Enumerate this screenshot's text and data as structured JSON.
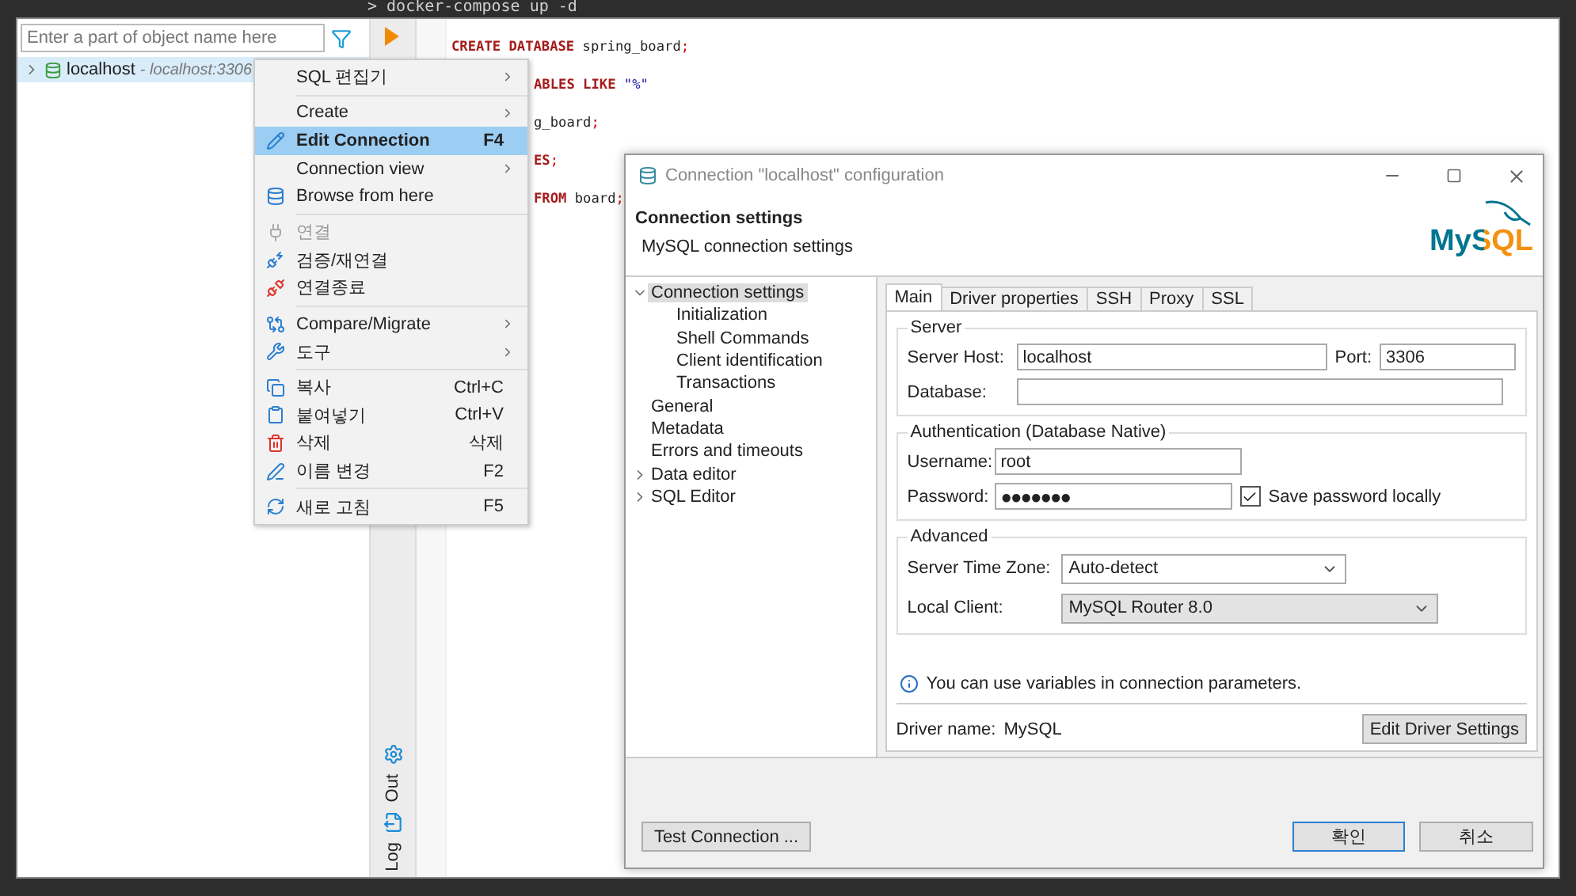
{
  "terminal": {
    "command": "> docker-compose up -d"
  },
  "navigator": {
    "search": {
      "placeholder": "Enter a part of object name here"
    },
    "tree": [
      {
        "label": "localhost",
        "detail": " - localhost:3306",
        "expanded": false,
        "selected": true
      }
    ]
  },
  "side_toolbar": {
    "tabs": [
      "Out",
      "Log"
    ]
  },
  "editor": {
    "lines": [
      {
        "clipped": false,
        "tokens": [
          {
            "kind": "keyword",
            "text": "CREATE DATABASE"
          },
          {
            "kind": "plain",
            "text": " spring_board"
          },
          {
            "kind": "punct",
            "text": ";"
          }
        ]
      },
      {
        "clipped": true,
        "tokens": [
          {
            "kind": "keyword",
            "text": "ABLES LIKE"
          },
          {
            "kind": "string",
            "text": " \"%\""
          }
        ]
      },
      {
        "clipped": true,
        "tokens": [
          {
            "kind": "plain",
            "text": "g_board"
          },
          {
            "kind": "punct",
            "text": ";"
          }
        ]
      },
      {
        "clipped": true,
        "tokens": [
          {
            "kind": "keyword",
            "text": "ES"
          },
          {
            "kind": "punct",
            "text": ";"
          }
        ]
      },
      {
        "clipped": true,
        "tokens": [
          {
            "kind": "keyword",
            "text": "FROM"
          },
          {
            "kind": "plain",
            "text": " board"
          },
          {
            "kind": "punct",
            "text": ";"
          }
        ]
      }
    ]
  },
  "context_menu": {
    "items": [
      {
        "kind": "item",
        "label": "SQL 편집기",
        "submenu": true,
        "disabled": false,
        "selected": false
      },
      {
        "kind": "separator"
      },
      {
        "kind": "item",
        "label": "Create",
        "submenu": true,
        "disabled": false,
        "selected": false
      },
      {
        "kind": "item",
        "label": "Edit Connection",
        "shortcut": "F4",
        "disabled": false,
        "selected": true
      },
      {
        "kind": "item",
        "label": "Connection view",
        "submenu": true,
        "disabled": false,
        "selected": false
      },
      {
        "kind": "item",
        "label": "Browse from here",
        "disabled": false,
        "selected": false
      },
      {
        "kind": "separator"
      },
      {
        "kind": "item",
        "label": "연결",
        "disabled": true,
        "selected": false
      },
      {
        "kind": "item",
        "label": "검증/재연결",
        "disabled": false,
        "selected": false
      },
      {
        "kind": "item",
        "label": "연결종료",
        "disabled": false,
        "selected": false
      },
      {
        "kind": "separator"
      },
      {
        "kind": "item",
        "label": "Compare/Migrate",
        "submenu": true,
        "disabled": false,
        "selected": false
      },
      {
        "kind": "item",
        "label": "도구",
        "submenu": true,
        "disabled": false,
        "selected": false
      },
      {
        "kind": "separator"
      },
      {
        "kind": "item",
        "label": "복사",
        "shortcut": "Ctrl+C",
        "disabled": false,
        "selected": false
      },
      {
        "kind": "item",
        "label": "붙여넣기",
        "shortcut": "Ctrl+V",
        "disabled": false,
        "selected": false
      },
      {
        "kind": "item",
        "label": "삭제",
        "shortcut": "삭제",
        "disabled": false,
        "selected": false
      },
      {
        "kind": "item",
        "label": "이름 변경",
        "shortcut": "F2",
        "disabled": false,
        "selected": false
      },
      {
        "kind": "separator"
      },
      {
        "kind": "item",
        "label": "새로 고침",
        "shortcut": "F5",
        "disabled": false,
        "selected": false
      }
    ]
  },
  "dialog": {
    "title": "Connection \"localhost\" configuration",
    "header": {
      "title": "Connection settings",
      "subtitle": "MySQL connection settings",
      "logo": "MySQL"
    },
    "tree": [
      {
        "label": "Connection settings",
        "expanded": true,
        "selected": true,
        "children": [
          {
            "label": "Initialization",
            "selected": false
          },
          {
            "label": "Shell Commands",
            "selected": false
          },
          {
            "label": "Client identification",
            "selected": false
          },
          {
            "label": "Transactions",
            "selected": false
          }
        ]
      },
      {
        "label": "General",
        "selected": false
      },
      {
        "label": "Metadata",
        "selected": false
      },
      {
        "label": "Errors and timeouts",
        "selected": false
      },
      {
        "label": "Data editor",
        "expanded": false,
        "selected": false
      },
      {
        "label": "SQL Editor",
        "expanded": false,
        "selected": false
      }
    ],
    "tabs": [
      {
        "label": "Main",
        "selected": true
      },
      {
        "label": "Driver properties",
        "selected": false
      },
      {
        "label": "SSH",
        "selected": false
      },
      {
        "label": "Proxy",
        "selected": false
      },
      {
        "label": "SSL",
        "selected": false
      }
    ],
    "server": {
      "title": "Server",
      "host_label": "Server Host:",
      "host": "localhost",
      "port_label": "Port:",
      "port": "3306",
      "database_label": "Database:"
    },
    "auth": {
      "title": "Authentication (Database Native)",
      "username_label": "Username:",
      "username": "root",
      "password_label": "Password:",
      "password": "●●●●●●●",
      "save_password": {
        "label": "Save password locally",
        "checked": true
      }
    },
    "advanced": {
      "title": "Advanced",
      "fields": [
        {
          "label": "Server Time Zone:",
          "value": "Auto-detect",
          "disabled": false
        },
        {
          "label": "Local Client:",
          "value": "MySQL Router 8.0",
          "disabled": true
        }
      ]
    },
    "info": "You can use variables in connection parameters.",
    "driver": {
      "label": "Driver name:",
      "value": "MySQL",
      "button": "Edit Driver Settings"
    },
    "buttons": {
      "test": "Test Connection ...",
      "ok": "확인",
      "cancel": "취소"
    }
  }
}
